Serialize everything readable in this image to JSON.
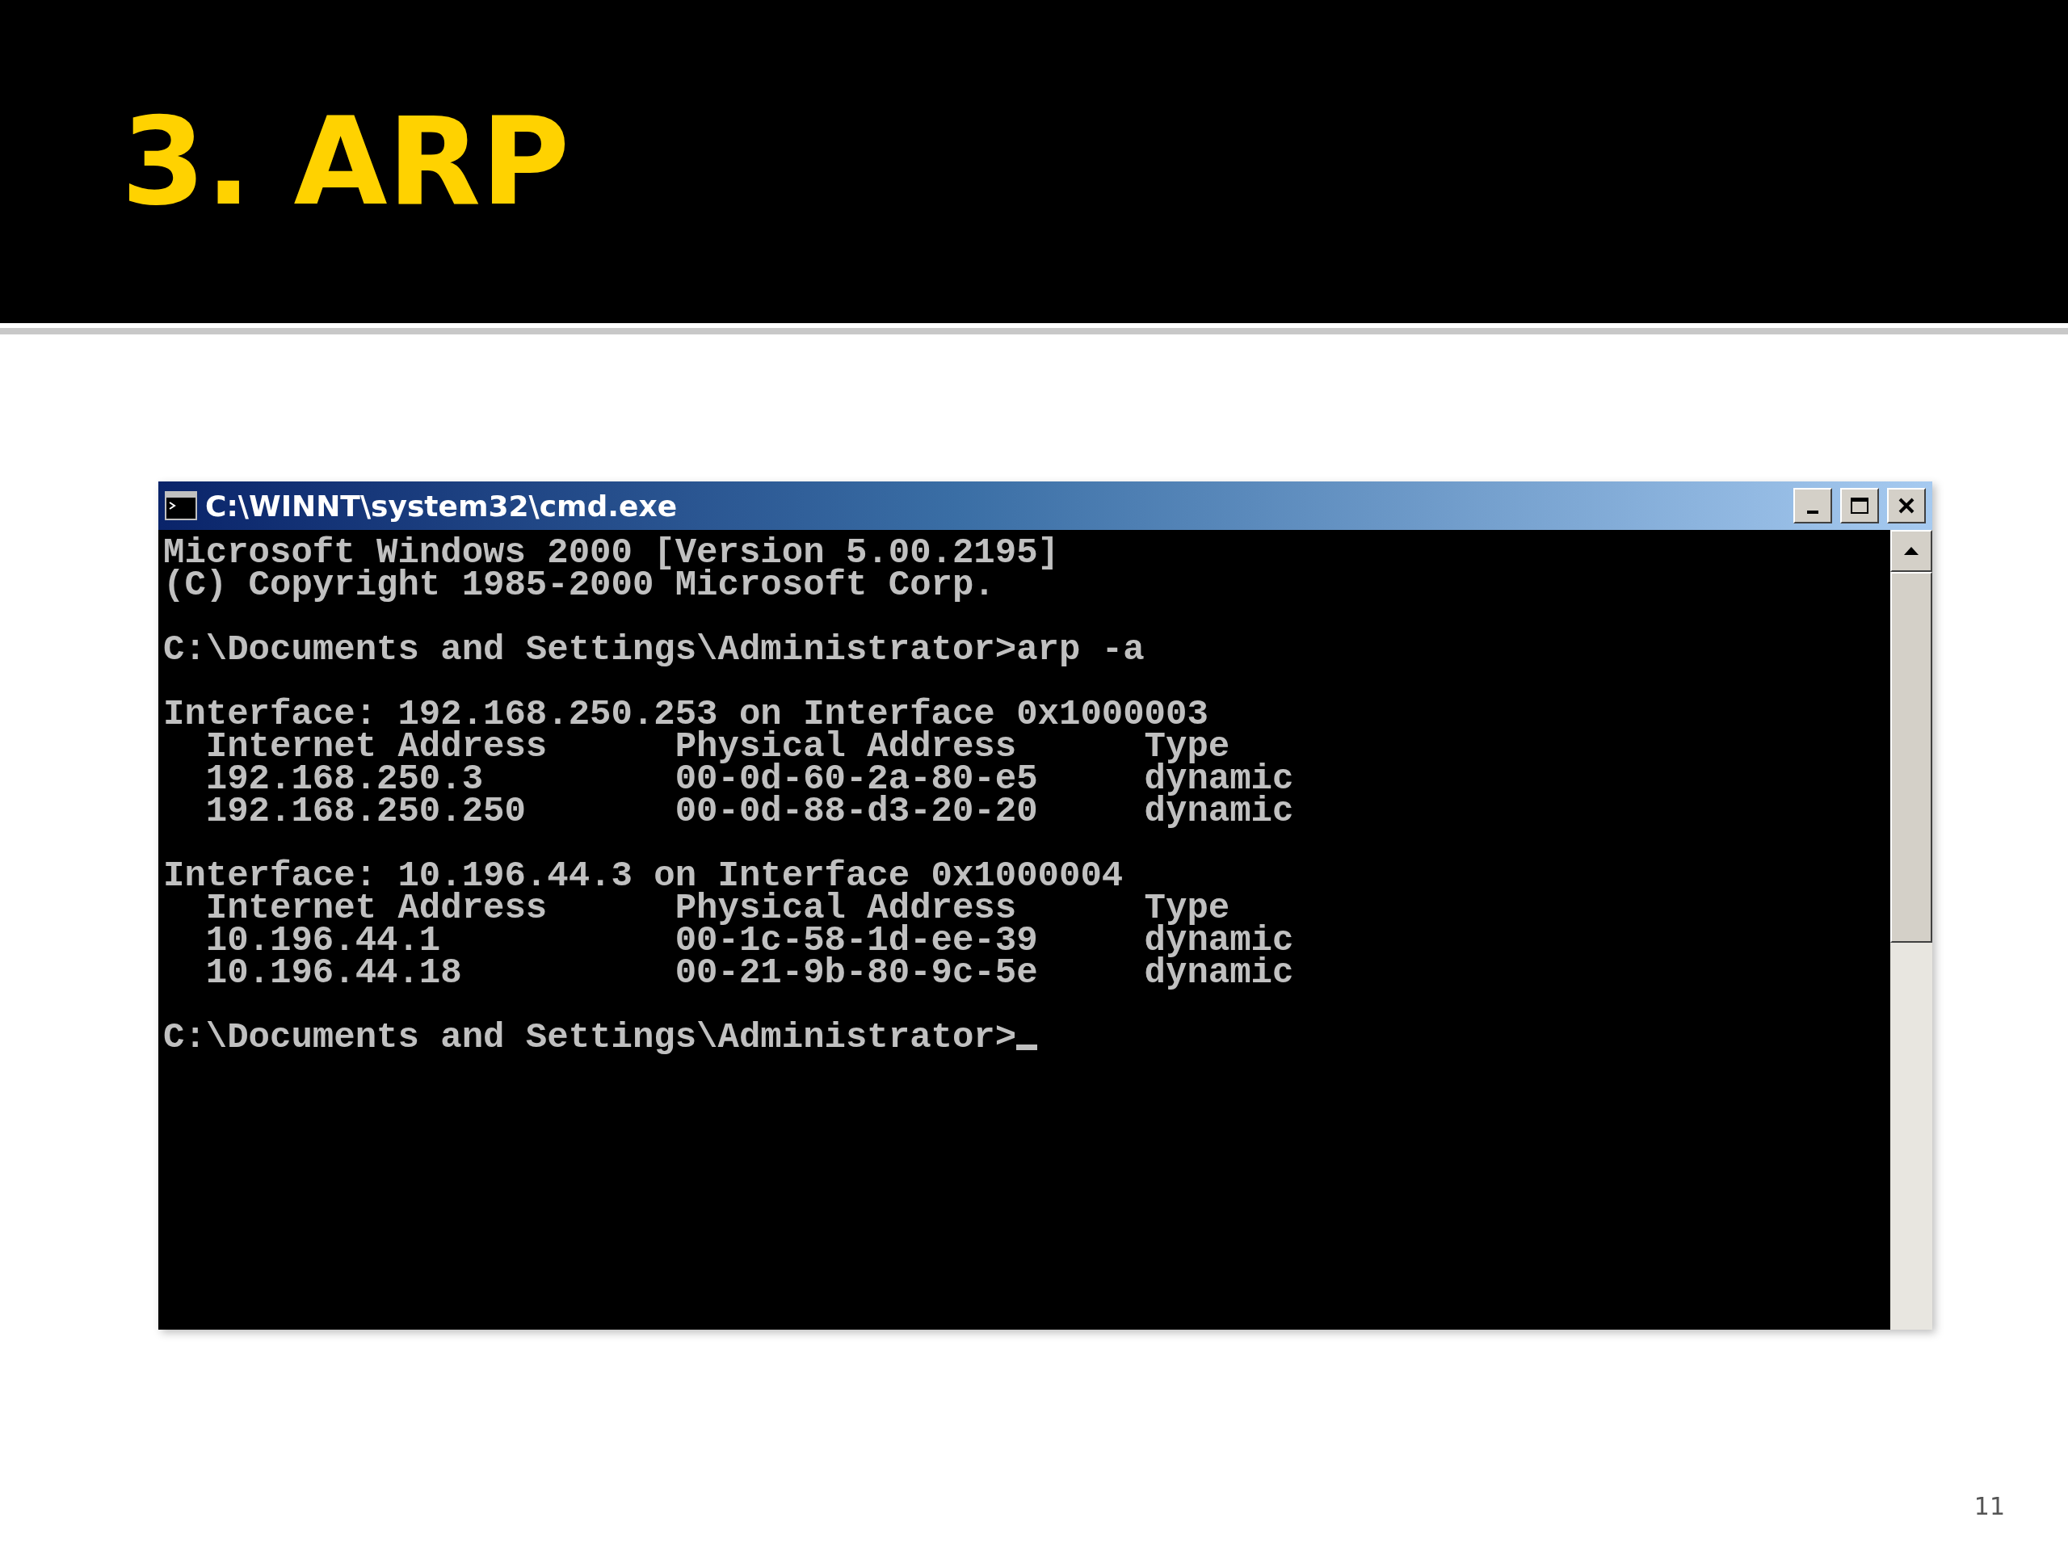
{
  "slide": {
    "title": "3. ARP",
    "page_number": "11"
  },
  "window": {
    "title": "C:\\WINNT\\system32\\cmd.exe"
  },
  "console": {
    "blocks": [
      [
        "Microsoft Windows 2000 [Version 5.00.2195]",
        "(C) Copyright 1985-2000 Microsoft Corp."
      ],
      [
        "C:\\Documents and Settings\\Administrator>arp -a"
      ],
      [
        "Interface: 192.168.250.253 on Interface 0x1000003",
        "  Internet Address      Physical Address      Type",
        "  192.168.250.3         00-0d-60-2a-80-e5     dynamic",
        "  192.168.250.250       00-0d-88-d3-20-20     dynamic"
      ],
      [
        "Interface: 10.196.44.3 on Interface 0x1000004",
        "  Internet Address      Physical Address      Type",
        "  10.196.44.1           00-1c-58-1d-ee-39     dynamic",
        "  10.196.44.18          00-21-9b-80-9c-5e     dynamic"
      ],
      [
        "C:\\Documents and Settings\\Administrator>"
      ]
    ]
  }
}
